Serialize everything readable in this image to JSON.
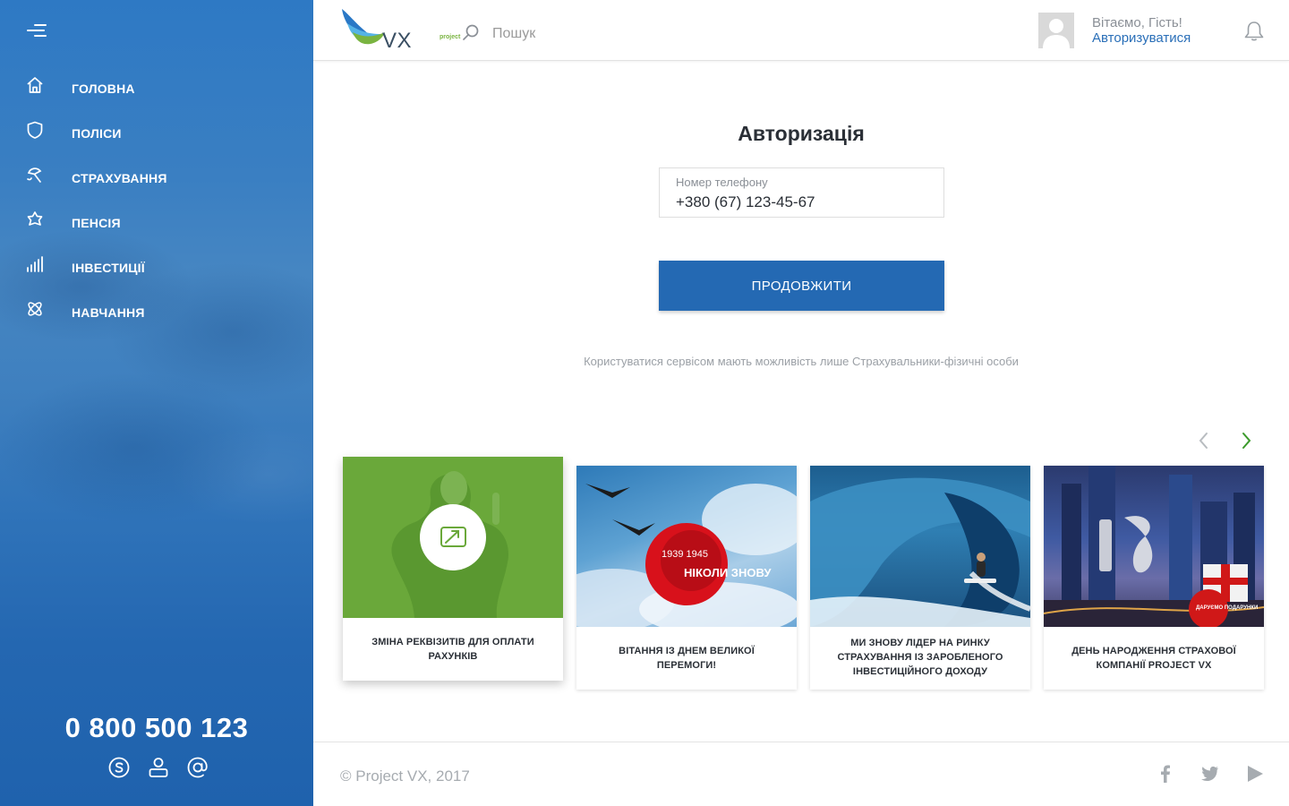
{
  "sidebar": {
    "menu_icon": "hamburger-icon",
    "items": [
      {
        "label": "ГОЛОВНА",
        "icon": "home-icon"
      },
      {
        "label": "ПОЛІСИ",
        "icon": "shield-icon"
      },
      {
        "label": "СТРАХУВАННЯ",
        "icon": "umbrella-icon"
      },
      {
        "label": "ПЕНСІЯ",
        "icon": "flower-icon"
      },
      {
        "label": "ІНВЕСТИЦІЇ",
        "icon": "bar-chart-icon"
      },
      {
        "label": "НАВЧАННЯ",
        "icon": "atom-icon"
      }
    ],
    "phone": "0 800 500 123",
    "contacts": [
      "skype-icon",
      "user-icon",
      "at-icon"
    ]
  },
  "header": {
    "logo_text": "VX",
    "logo_sub": "project",
    "search_placeholder": "Пошук",
    "greeting": "Вітаємо, Гість!",
    "login_link": "Авторизуватися"
  },
  "auth": {
    "title": "Авторизація",
    "phone_label": "Номер телефону",
    "phone_value": "+380 (67) 123-45-67",
    "continue_label": "ПРОДОВЖИТИ",
    "note": "Користуватися сервісом мають можливість лише Страхувальники-фізичні особи"
  },
  "news": [
    {
      "caption": "ЗМІНА РЕКВІЗИТІВ ДЛЯ ОПЛАТИ РАХУНКІВ"
    },
    {
      "caption": "ВІТАННЯ ІЗ ДНЕМ ВЕЛИКОЇ ПЕРЕМОГИ!",
      "badge_years": "1939 1945",
      "badge_text": "НІКОЛИ ЗНОВУ"
    },
    {
      "caption": "МИ ЗНОВУ ЛІДЕР НА РИНКУ СТРАХУВАННЯ ІЗ ЗАРОБЛЕНОГО ІНВЕСТИЦІЙНОГО ДОХОДУ"
    },
    {
      "caption": "ДЕНЬ НАРОДЖЕННЯ СТРАХОВОЇ КОМПАНІЇ PROJECT VX",
      "badge_text": "ДАРУЄМО ПОДАРУНКИ"
    }
  ],
  "footer": {
    "copyright": "© Project VX, 2017",
    "social": [
      "facebook-icon",
      "twitter-icon",
      "youtube-icon"
    ]
  },
  "colors": {
    "sidebar": "#2e79c4",
    "primary_button": "#2469b3",
    "link": "#2a6fb8",
    "accent_green": "#7ab441",
    "arrow_active": "#3b9a2b"
  }
}
